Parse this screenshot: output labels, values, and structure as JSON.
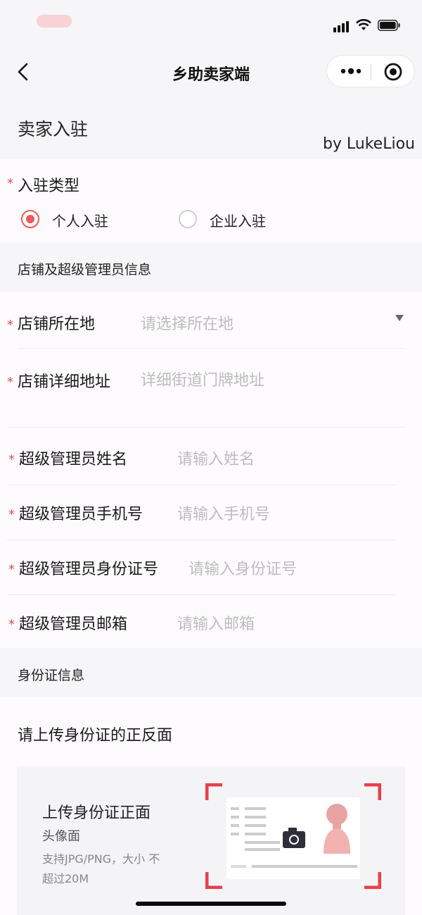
{
  "nav": {
    "title": "乡助卖家端"
  },
  "header": {
    "title": "卖家入驻",
    "author": "by LukeLiou"
  },
  "settle_type": {
    "label": "入驻类型",
    "options": [
      {
        "label": "个人入驻",
        "selected": true
      },
      {
        "label": "企业入驻",
        "selected": false
      }
    ]
  },
  "shop_section": {
    "title": "店铺及超级管理员信息"
  },
  "fields": {
    "location": {
      "label": "店铺所在地",
      "placeholder": "请选择所在地"
    },
    "address": {
      "label": "店铺详细地址",
      "placeholder": "详细街道门牌地址"
    },
    "admin_name": {
      "label": "超级管理员姓名",
      "placeholder": "请输入姓名"
    },
    "admin_phone": {
      "label": "超级管理员手机号",
      "placeholder": "请输入手机号"
    },
    "admin_id": {
      "label": "超级管理员身份证号",
      "placeholder": "请输入身份证号"
    },
    "admin_email": {
      "label": "超级管理员邮箱",
      "placeholder": "请输入邮箱"
    }
  },
  "id_section": {
    "title": "身份证信息"
  },
  "upload": {
    "prompt": "请上传身份证的正反面",
    "front_title": "上传身份证正面",
    "front_sub": "头像面",
    "hint": "支持JPG/PNG，大小 不超过20M"
  },
  "colors": {
    "accent": "#f0585c",
    "required": "#e34b50",
    "placeholder": "#bdbdbd"
  },
  "icons": [
    "back-arrow-icon",
    "more-dots-icon",
    "target-icon",
    "camera-icon",
    "dropdown-arrow-icon"
  ]
}
